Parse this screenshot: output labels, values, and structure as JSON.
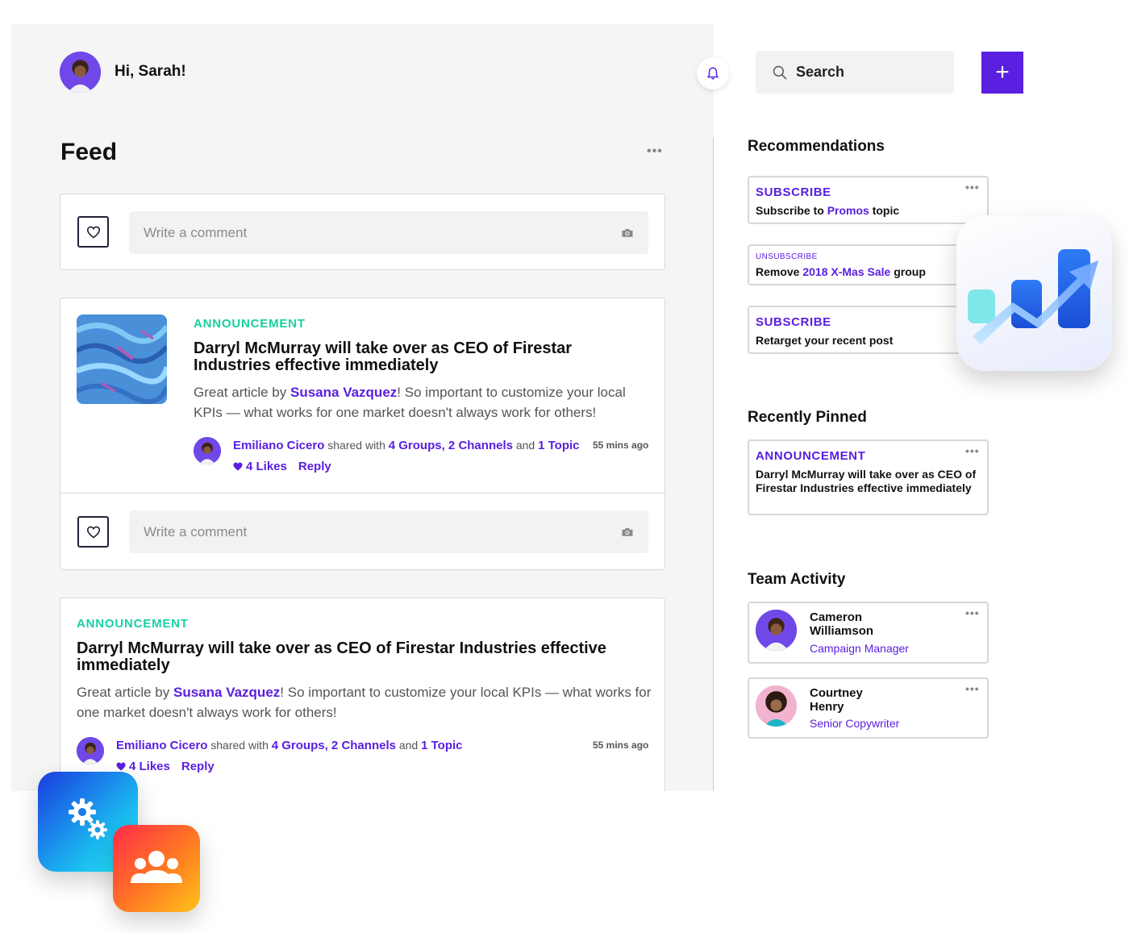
{
  "header": {
    "greeting": "Hi, Sarah!",
    "search_placeholder": "Search",
    "add_button": "+"
  },
  "feed": {
    "title": "Feed",
    "more": "•••",
    "comment_placeholder": "Write a comment",
    "posts": [
      {
        "tag": "ANNOUNCEMENT",
        "title": "Darryl McMurray will take over as CEO of Firestar Industries effective immediately",
        "body_prefix": "Great article by ",
        "body_author": "Susana Vazquez",
        "body_suffix": "! So important to customize your local KPIs — what works for one market doesn't always work for others!",
        "sharer": "Emiliano Cicero",
        "shared_with_text": " shared with ",
        "groups": "4 Groups, 2 Channels",
        "and_text": " and ",
        "topics": "1 Topic",
        "time": "55 mins ago",
        "likes": "4 Likes",
        "reply": "Reply"
      },
      {
        "tag": "ANNOUNCEMENT",
        "title": "Darryl McMurray will take over as CEO of Firestar Industries effective immediately",
        "body_prefix": "Great article by ",
        "body_author": "Susana Vazquez",
        "body_suffix": "! So important to customize your local KPIs — what works for one market doesn't always work for others!",
        "sharer": "Emiliano Cicero",
        "shared_with_text": " shared with ",
        "groups": "4 Groups, 2 Channels",
        "and_text": " and ",
        "topics": "1 Topic",
        "time": "55 mins ago",
        "likes": "4 Likes",
        "reply": "Reply"
      }
    ]
  },
  "recommendations": {
    "title": "Recommendations",
    "items": [
      {
        "tag": "SUBSCRIBE",
        "text_prefix": "Subscribe to ",
        "highlight": "Promos",
        "text_suffix": " topic"
      },
      {
        "tag": "UNSUBSCRIBE",
        "text_prefix": "Remove ",
        "highlight": "2018 X-Mas Sale",
        "text_suffix": " group"
      },
      {
        "tag": "SUBSCRIBE",
        "text_prefix": "Retarget your recent post",
        "highlight": "",
        "text_suffix": ""
      }
    ]
  },
  "recently_pinned": {
    "title": "Recently Pinned",
    "tag": "ANNOUNCEMENT",
    "text": "Darryl McMurray will take over as CEO of Firestar Industries effective immediately"
  },
  "team_activity": {
    "title": "Team Activity",
    "members": [
      {
        "name_line1": "Cameron",
        "name_line2": "Williamson",
        "role": "Campaign Manager"
      },
      {
        "name_line1": "Courtney",
        "name_line2": "Henry",
        "role": "Senior Copywriter"
      }
    ]
  },
  "colors": {
    "accent": "#5a1fe0",
    "announcement": "#18d0a0",
    "panel_bg": "#f5f5f5"
  },
  "icons": [
    "bell-icon",
    "search-icon",
    "plus-icon",
    "heart-icon",
    "camera-icon",
    "more-icon",
    "trend-chart-icon",
    "gears-icon",
    "team-icon"
  ]
}
